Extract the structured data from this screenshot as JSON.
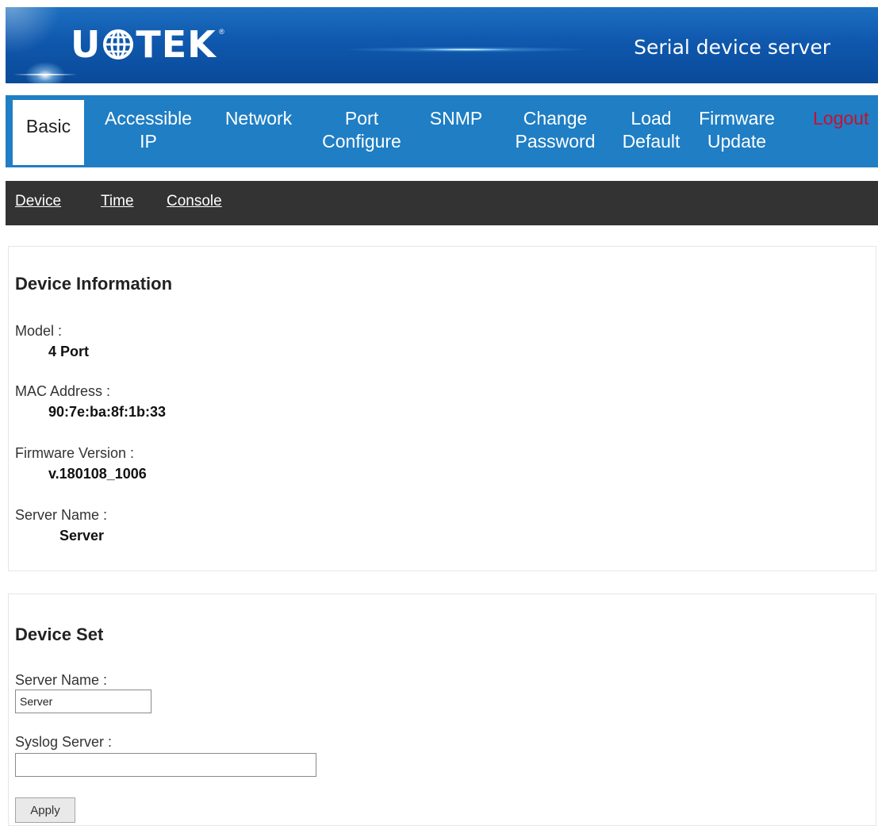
{
  "banner": {
    "logo_left": "U",
    "logo_right": "TEK",
    "logo_reg": "®",
    "title": "Serial device server"
  },
  "nav": {
    "items": [
      {
        "label": "Basic"
      },
      {
        "label_lines": [
          "Accessible",
          "IP"
        ]
      },
      {
        "label": "Network"
      },
      {
        "label_lines": [
          "Port",
          "Configure"
        ]
      },
      {
        "label": "SNMP"
      },
      {
        "label_lines": [
          "Change",
          "Password"
        ]
      },
      {
        "label_lines": [
          "Load",
          "Default"
        ]
      },
      {
        "label_lines": [
          "Firmware",
          "Update"
        ]
      },
      {
        "label": "Logout"
      }
    ],
    "active": "Basic"
  },
  "subnav": {
    "items": [
      "Device",
      "Time",
      "Console"
    ]
  },
  "device_info": {
    "heading": "Device Information",
    "model_label": "Model :",
    "model_value": "4 Port",
    "mac_label": "MAC Address :",
    "mac_value": "90:7e:ba:8f:1b:33",
    "fw_label": "Firmware Version :",
    "fw_value": "v.180108_1006",
    "server_name_label": "Server Name :",
    "server_name_value": "Server"
  },
  "device_set": {
    "heading": "Device Set",
    "server_name_label": "Server Name :",
    "server_name_input": "Server",
    "syslog_label": "Syslog Server :",
    "syslog_input": "",
    "apply_label": "Apply"
  },
  "colors": {
    "banner_blue": "#0f58ad",
    "nav_blue": "#1f7ec4",
    "subnav_dark": "#333333",
    "logout_red": "#c4122f"
  }
}
